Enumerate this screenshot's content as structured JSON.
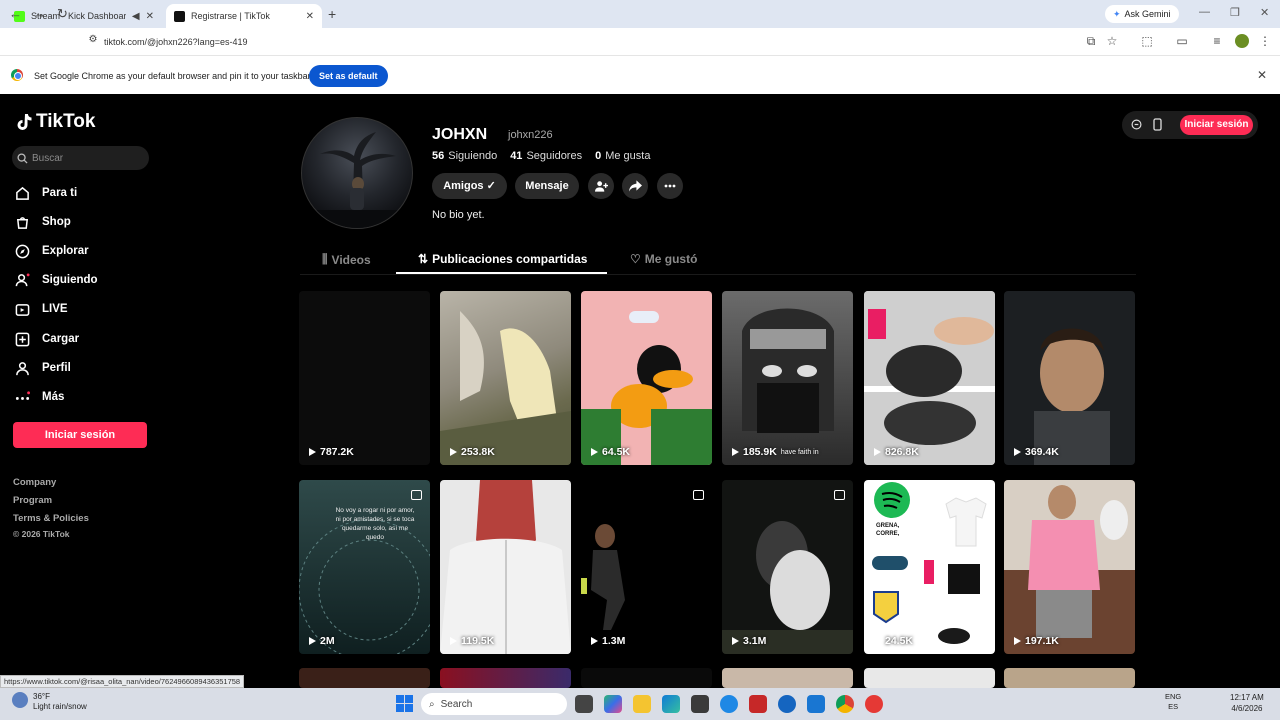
{
  "browser": {
    "tabs": [
      {
        "title": "Stream - Kick Dashboard",
        "active": false
      },
      {
        "title": "Registrarse | TikTok",
        "active": true
      }
    ],
    "ask_gemini": "Ask Gemini",
    "url": "tiktok.com/@johxn226?lang=es-419",
    "infobar_text": "Set Google Chrome as your default browser and pin it to your taskbar",
    "infobar_button": "Set as default",
    "status_url": "https://www.tiktok.com/@risaa_olita_nan/video/7624966089436351758"
  },
  "sidebar": {
    "brand": "TikTok",
    "search_placeholder": "Buscar",
    "items": [
      {
        "label": "Para ti",
        "icon": "home-icon"
      },
      {
        "label": "Shop",
        "icon": "shop-icon"
      },
      {
        "label": "Explorar",
        "icon": "compass-icon"
      },
      {
        "label": "Siguiendo",
        "icon": "following-icon"
      },
      {
        "label": "LIVE",
        "icon": "live-icon"
      },
      {
        "label": "Cargar",
        "icon": "upload-icon"
      },
      {
        "label": "Perfil",
        "icon": "profile-icon"
      },
      {
        "label": "Más",
        "icon": "more-icon"
      }
    ],
    "login_button": "Iniciar sesión",
    "footer": [
      "Company",
      "Program",
      "Terms & Policies",
      "© 2026 TikTok"
    ]
  },
  "header": {
    "login_button": "Iniciar sesión"
  },
  "profile": {
    "display_name": "JOHXN",
    "username": "johxn226",
    "following_count": "56",
    "following_label": "Siguiendo",
    "followers_count": "41",
    "followers_label": "Seguidores",
    "likes_count": "0",
    "likes_label": "Me gusta",
    "friends_button": "Amigos ✓",
    "message_button": "Mensaje",
    "bio": "No bio yet."
  },
  "tabs": [
    {
      "label": "Videos",
      "active": false
    },
    {
      "label": "Publicaciones compartidas",
      "active": true
    },
    {
      "label": "Me gustó",
      "active": false
    }
  ],
  "videos": [
    {
      "views": "787.2K",
      "caption": "",
      "photo": false
    },
    {
      "views": "253.8K",
      "caption": "",
      "photo": false
    },
    {
      "views": "64.5K",
      "caption": "",
      "photo": false
    },
    {
      "views": "185.9K",
      "caption": "have faith in",
      "photo": false
    },
    {
      "views": "826.8K",
      "caption": "",
      "photo": false
    },
    {
      "views": "369.4K",
      "caption": "",
      "photo": false
    },
    {
      "views": "2M",
      "caption": "No voy a rogar ni por amor, ni por amistades, si se toca quedarme solo, así me quedo",
      "photo": true
    },
    {
      "views": "119.5K",
      "caption": "",
      "photo": false
    },
    {
      "views": "1.3M",
      "caption": "",
      "photo": true
    },
    {
      "views": "3.1M",
      "caption": "",
      "photo": true
    },
    {
      "views": "24.5K",
      "caption": "GRENA, CORRE,",
      "photo": false
    },
    {
      "views": "197.1K",
      "caption": "",
      "photo": false
    }
  ],
  "taskbar": {
    "temperature": "36°F",
    "weather": "Light rain/snow",
    "search": "Search",
    "lang_top": "ENG",
    "lang_bottom": "ES",
    "time": "12:17 AM",
    "date": "4/6/2026"
  },
  "colors": {
    "accent": "#fe2c55",
    "chrome_blue": "#0b57d0"
  }
}
